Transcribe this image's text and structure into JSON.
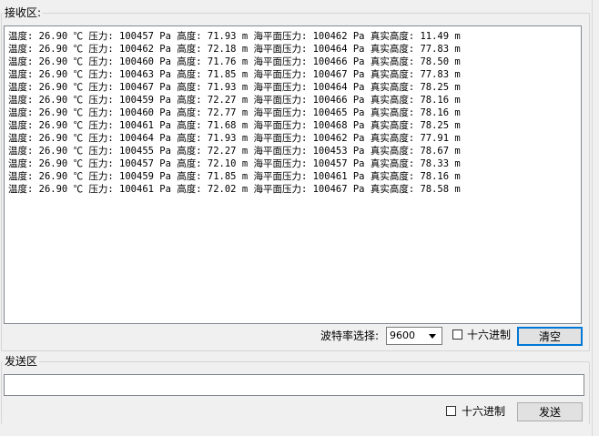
{
  "receive": {
    "group_title": "接收区:",
    "lines": [
      "温度: 26.90 ℃ 压力: 100457 Pa 高度: 71.93 m 海平面压力: 100462 Pa 真实高度: 11.49 m",
      "温度: 26.90 ℃ 压力: 100462 Pa 高度: 72.18 m 海平面压力: 100464 Pa 真实高度: 77.83 m",
      "温度: 26.90 ℃ 压力: 100460 Pa 高度: 71.76 m 海平面压力: 100466 Pa 真实高度: 78.50 m",
      "温度: 26.90 ℃ 压力: 100463 Pa 高度: 71.85 m 海平面压力: 100467 Pa 真实高度: 77.83 m",
      "温度: 26.90 ℃ 压力: 100467 Pa 高度: 71.93 m 海平面压力: 100464 Pa 真实高度: 78.25 m",
      "温度: 26.90 ℃ 压力: 100459 Pa 高度: 72.27 m 海平面压力: 100466 Pa 真实高度: 78.16 m",
      "温度: 26.90 ℃ 压力: 100460 Pa 高度: 72.77 m 海平面压力: 100465 Pa 真实高度: 78.16 m",
      "温度: 26.90 ℃ 压力: 100461 Pa 高度: 71.68 m 海平面压力: 100468 Pa 真实高度: 78.25 m",
      "温度: 26.90 ℃ 压力: 100464 Pa 高度: 71.93 m 海平面压力: 100462 Pa 真实高度: 77.91 m",
      "温度: 26.90 ℃ 压力: 100455 Pa 高度: 72.27 m 海平面压力: 100453 Pa 真实高度: 78.67 m",
      "温度: 26.90 ℃ 压力: 100457 Pa 高度: 72.10 m 海平面压力: 100457 Pa 真实高度: 78.33 m",
      "温度: 26.90 ℃ 压力: 100459 Pa 高度: 71.85 m 海平面压力: 100461 Pa 真实高度: 78.16 m",
      "温度: 26.90 ℃ 压力: 100461 Pa 高度: 72.02 m 海平面压力: 100467 Pa 真实高度: 78.58 m"
    ],
    "baud_label": "波特率选择:",
    "baud_value": "9600",
    "hex_label": "十六进制",
    "hex_checked": false,
    "clear_button": "清空"
  },
  "send": {
    "group_title": "发送区",
    "input_value": "",
    "hex_label": "十六进制",
    "hex_checked": false,
    "send_button": "发送"
  },
  "colors": {
    "window_bg": "#f0f0f0",
    "focus_border": "#0078d7",
    "button_bg": "#e1e1e1"
  }
}
